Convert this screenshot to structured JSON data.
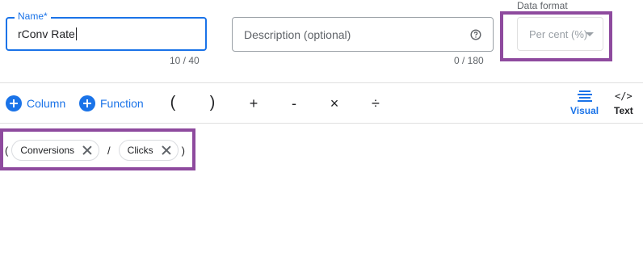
{
  "name_field": {
    "label": "Name*",
    "value": "rConv Rate",
    "counter": "10 / 40"
  },
  "description_field": {
    "placeholder": "Description (optional)",
    "counter": "0 / 180",
    "icon": "help-circle-icon"
  },
  "data_format": {
    "title": "Data format",
    "selected": "Per cent (%)"
  },
  "toolbar": {
    "column_label": "Column",
    "function_label": "Function",
    "operators": [
      "(",
      ")",
      "+",
      "-",
      "×",
      "÷"
    ],
    "modes": {
      "visual": "Visual",
      "text": "Text"
    }
  },
  "formula": {
    "open_paren": "(",
    "chips": [
      "Conversions",
      "Clicks"
    ],
    "operator": "/",
    "close_paren": ")"
  },
  "colors": {
    "accent": "#1a73e8",
    "highlight": "#8e4a9e"
  }
}
